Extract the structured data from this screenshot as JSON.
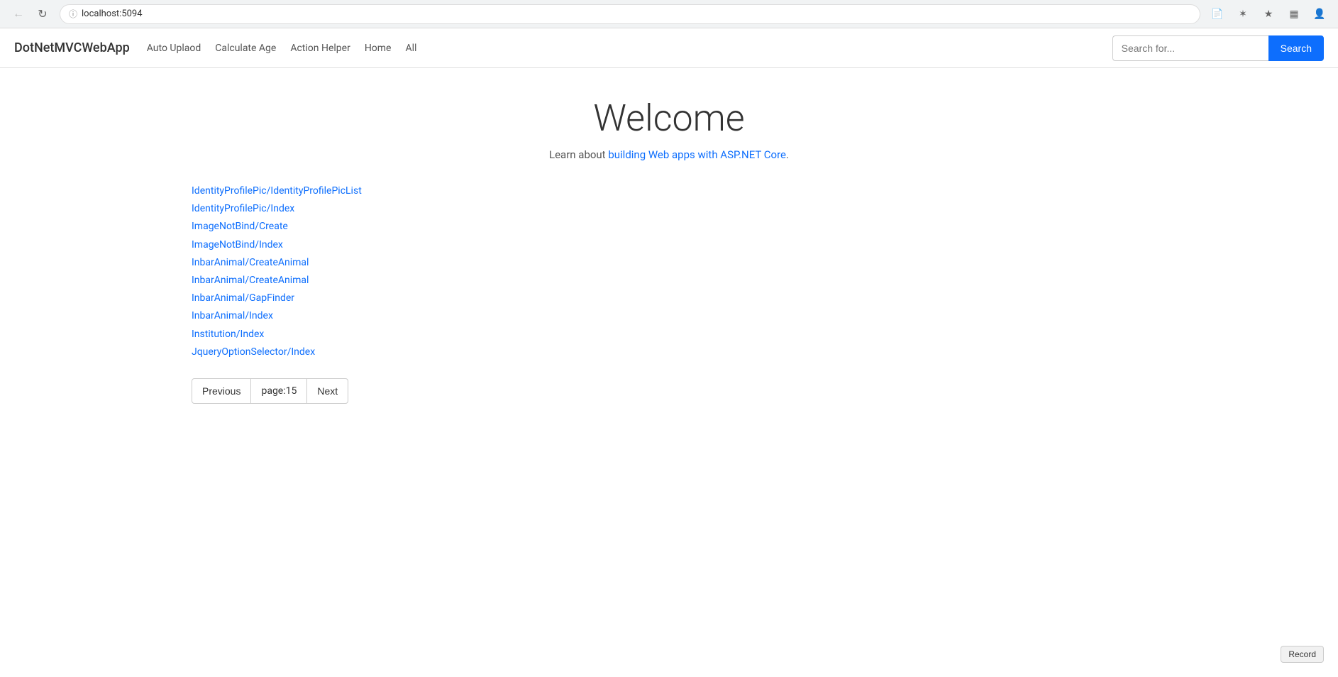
{
  "browser": {
    "url": "localhost:5094",
    "back_disabled": true,
    "reload_title": "Reload page"
  },
  "navbar": {
    "brand": "DotNetMVCWebApp",
    "links": [
      {
        "label": "Auto Uplaod",
        "href": "#"
      },
      {
        "label": "Calculate Age",
        "href": "#"
      },
      {
        "label": "Action Helper",
        "href": "#"
      },
      {
        "label": "Home",
        "href": "#"
      },
      {
        "label": "All",
        "href": "#"
      }
    ],
    "search_placeholder": "Search for...",
    "search_button_label": "Search"
  },
  "main": {
    "heading": "Welcome",
    "subtext_prefix": "Learn about ",
    "subtext_link_label": "building Web apps with ASP.NET Core",
    "subtext_link_href": "#",
    "subtext_suffix": ".",
    "links": [
      {
        "label": "IdentityProfilePic/IdentityProfilePicList",
        "href": "#"
      },
      {
        "label": "IdentityProfilePic/Index",
        "href": "#"
      },
      {
        "label": "ImageNotBind/Create",
        "href": "#"
      },
      {
        "label": "ImageNotBind/Index",
        "href": "#"
      },
      {
        "label": "InbarAnimal/CreateAnimal",
        "href": "#"
      },
      {
        "label": "InbarAnimal/CreateAnimal",
        "href": "#"
      },
      {
        "label": "InbarAnimal/GapFinder",
        "href": "#"
      },
      {
        "label": "InbarAnimal/Index",
        "href": "#"
      },
      {
        "label": "Institution/Index",
        "href": "#"
      },
      {
        "label": "JqueryOptionSelector/Index",
        "href": "#"
      }
    ],
    "pagination": {
      "previous_label": "Previous",
      "page_label": "page:",
      "page_number": "15",
      "next_label": "Next"
    }
  },
  "record_button_label": "Record"
}
